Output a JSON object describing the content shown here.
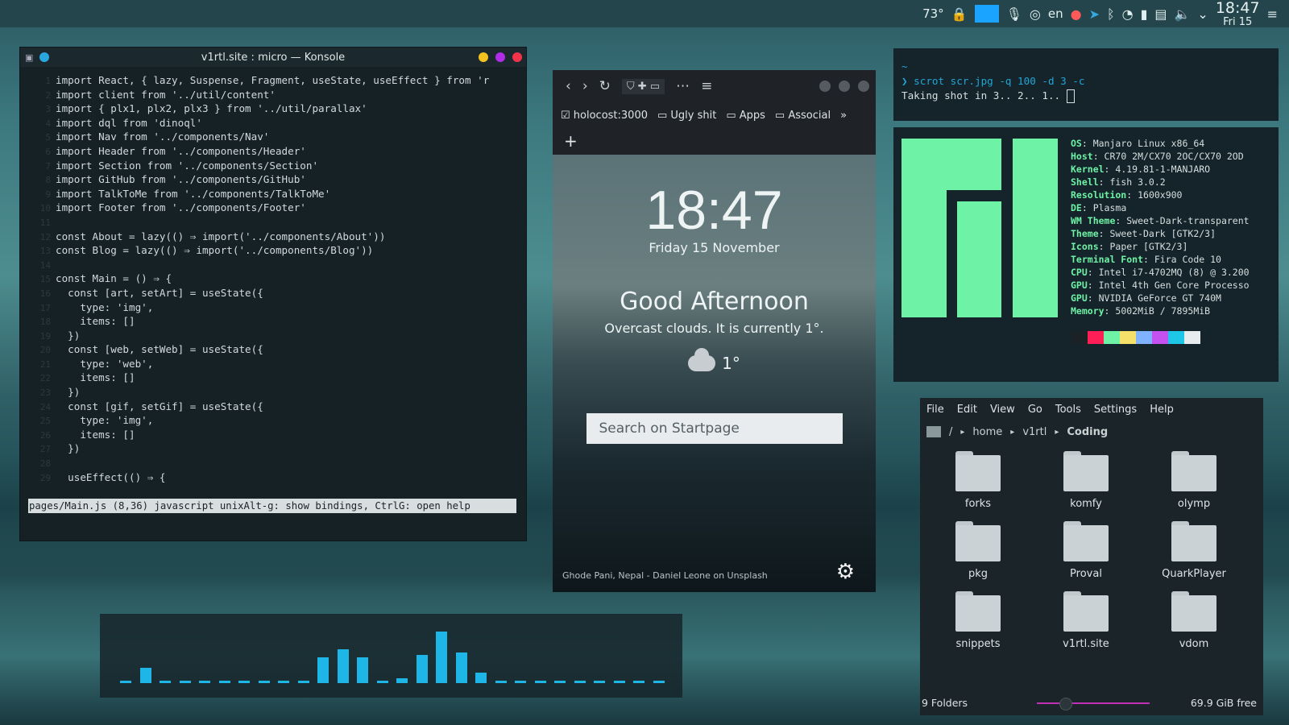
{
  "panel": {
    "temp": "73°",
    "lang": "en",
    "clock_time": "18:47",
    "clock_date": "Fri 15",
    "tray_icons": [
      "lock-icon",
      "blue-square-icon",
      "microphone-icon",
      "contacts-icon",
      "ghost-icon",
      "telegram-icon",
      "bluetooth-icon",
      "wifi-icon",
      "battery-icon",
      "clipboard-icon",
      "volume-icon",
      "chevron-down-icon",
      "notifications-icon"
    ]
  },
  "konsole": {
    "title": "v1rtl.site : micro — Konsole",
    "lines": [
      "import React, { lazy, Suspense, Fragment, useState, useEffect } from 'r",
      "import client from '../util/content'",
      "import { plx1, plx2, plx3 } from '../util/parallax'",
      "import dql from 'dinoql'",
      "import Nav from '../components/Nav'",
      "import Header from '../components/Header'",
      "import Section from '../components/Section'",
      "import GitHub from '../components/GitHub'",
      "import TalkToMe from '../components/TalkToMe'",
      "import Footer from '../components/Footer'",
      "",
      "const About = lazy(() ⇒ import('../components/About'))",
      "const Blog = lazy(() ⇒ import('../components/Blog'))",
      "",
      "const Main = () ⇒ {",
      "  const [art, setArt] = useState({",
      "    type: 'img',",
      "    items: []",
      "  })",
      "  const [web, setWeb] = useState({",
      "    type: 'web',",
      "    items: []",
      "  })",
      "  const [gif, setGif] = useState({",
      "    type: 'img',",
      "    items: []",
      "  })",
      "",
      "  useEffect(() ⇒ {"
    ],
    "status": "pages/Main.js (8,36) javascript unixAlt-g: show bindings, CtrlG: open help"
  },
  "browser": {
    "bookmarks": [
      "holocost:3000",
      "Ugly shit",
      "Apps",
      "Associal"
    ],
    "time": "18:47",
    "date": "Friday 15 November",
    "greeting": "Good Afternoon",
    "weather_text": "Overcast clouds. It is currently 1°.",
    "temp": "1°",
    "search_placeholder": "Search on Startpage",
    "credit": "Ghode Pani, Nepal - Daniel Leone on Unsplash"
  },
  "terminal": {
    "prompt_home": "~",
    "command": "❯ scrot scr.jpg -q 100 -d 3 -c",
    "output": "Taking shot in 3.. 2.. 1.. "
  },
  "neofetch": {
    "rows": [
      {
        "k": "OS",
        "v": ": Manjaro Linux x86_64"
      },
      {
        "k": "Host",
        "v": ": CR70 2M/CX70 2OC/CX70 2OD"
      },
      {
        "k": "Kernel",
        "v": ": 4.19.81-1-MANJARO"
      },
      {
        "k": "Shell",
        "v": ": fish 3.0.2"
      },
      {
        "k": "Resolution",
        "v": ": 1600x900"
      },
      {
        "k": "DE",
        "v": ": Plasma"
      },
      {
        "k": "WM Theme",
        "v": ": Sweet-Dark-transparent"
      },
      {
        "k": "Theme",
        "v": ": Sweet-Dark [GTK2/3]"
      },
      {
        "k": "Icons",
        "v": ": Paper [GTK2/3]"
      },
      {
        "k": "Terminal Font",
        "v": ": Fira Code 10"
      },
      {
        "k": "CPU",
        "v": ": Intel i7-4702MQ (8) @ 3.200"
      },
      {
        "k": "GPU",
        "v": ": Intel 4th Gen Core Processo"
      },
      {
        "k": "GPU",
        "v": ": NVIDIA GeForce GT 740M"
      },
      {
        "k": "Memory",
        "v": ": 5002MiB / 7895MiB"
      }
    ],
    "colors": [
      "#1b2226",
      "#ff1f56",
      "#6ef2a6",
      "#f5e06a",
      "#7fb2ff",
      "#c451f0",
      "#1ec6e8",
      "#e9ecee"
    ],
    "logo_color": "#6ef2a6"
  },
  "filemanager": {
    "menu": [
      "File",
      "Edit",
      "View",
      "Go",
      "Tools",
      "Settings",
      "Help"
    ],
    "crumbs": [
      "/",
      "home",
      "v1rtl",
      "Coding"
    ],
    "folders": [
      "forks",
      "komfy",
      "olymp",
      "pkg",
      "Proval",
      "QuarkPlayer",
      "snippets",
      "v1rtl.site",
      "vdom"
    ],
    "status_left": "9 Folders",
    "status_right": "69.9 GiB free"
  },
  "visualizer": {
    "levels": [
      0.05,
      0.3,
      0.05,
      0.05,
      0.05,
      0.05,
      0.05,
      0.05,
      0.05,
      0.05,
      0.5,
      0.65,
      0.5,
      0.05,
      0.1,
      0.55,
      1.0,
      0.6,
      0.2,
      0.05,
      0.05,
      0.05,
      0.05,
      0.05,
      0.05,
      0.05,
      0.05,
      0.05
    ],
    "color": "#1eb6e6"
  }
}
